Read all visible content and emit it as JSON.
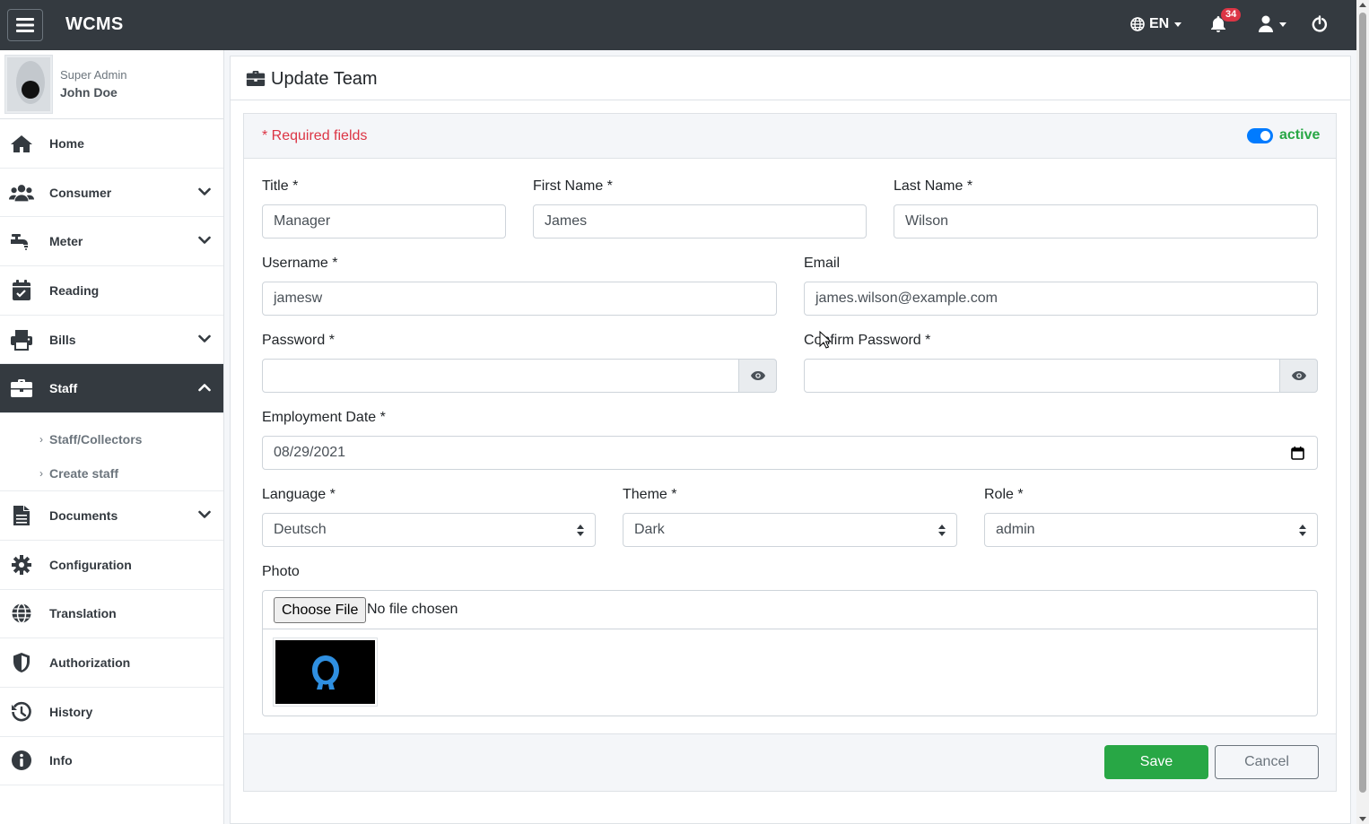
{
  "navbar": {
    "brand": "WCMS",
    "language": "EN",
    "notification_count": "34"
  },
  "sidebar": {
    "user_role": "Super Admin",
    "user_name": "John Doe",
    "items": [
      {
        "label": "Home",
        "icon": "home-icon"
      },
      {
        "label": "Consumer",
        "icon": "users-icon"
      },
      {
        "label": "Meter",
        "icon": "faucet-icon"
      },
      {
        "label": "Reading",
        "icon": "calendar-check-icon"
      },
      {
        "label": "Bills",
        "icon": "printer-icon"
      },
      {
        "label": "Staff",
        "icon": "briefcase-icon"
      },
      {
        "label": "Documents",
        "icon": "file-icon"
      },
      {
        "label": "Configuration",
        "icon": "gear-icon"
      },
      {
        "label": "Translation",
        "icon": "globe-icon"
      },
      {
        "label": "Authorization",
        "icon": "shield-icon"
      },
      {
        "label": "History",
        "icon": "history-icon"
      },
      {
        "label": "Info",
        "icon": "info-icon"
      }
    ],
    "staff_sub": [
      {
        "label": "Staff/Collectors"
      },
      {
        "label": "Create staff"
      }
    ]
  },
  "page": {
    "title": "Update Team",
    "required_note": "* Required fields",
    "status_label": "active"
  },
  "form": {
    "title_label": "Title *",
    "title_value": "Manager",
    "first_name_label": "First Name *",
    "first_name_value": "James",
    "last_name_label": "Last Name *",
    "last_name_value": "Wilson",
    "username_label": "Username *",
    "username_value": "jamesw",
    "email_label": "Email",
    "email_value": "james.wilson@example.com",
    "password_label": "Password *",
    "confirm_password_label": "Confirm Password *",
    "employment_date_label": "Employment Date *",
    "employment_date_value": "08/29/2021",
    "language_label": "Language *",
    "language_value": "Deutsch",
    "theme_label": "Theme *",
    "theme_value": "Dark",
    "role_label": "Role *",
    "role_value": "admin",
    "photo_label": "Photo",
    "choose_file_label": "Choose File",
    "no_file_label": "No file chosen",
    "save_label": "Save",
    "cancel_label": "Cancel"
  },
  "colors": {
    "navbar": "#343a40",
    "save": "#28a745",
    "required": "#dc3545",
    "toggle": "#007bff"
  }
}
